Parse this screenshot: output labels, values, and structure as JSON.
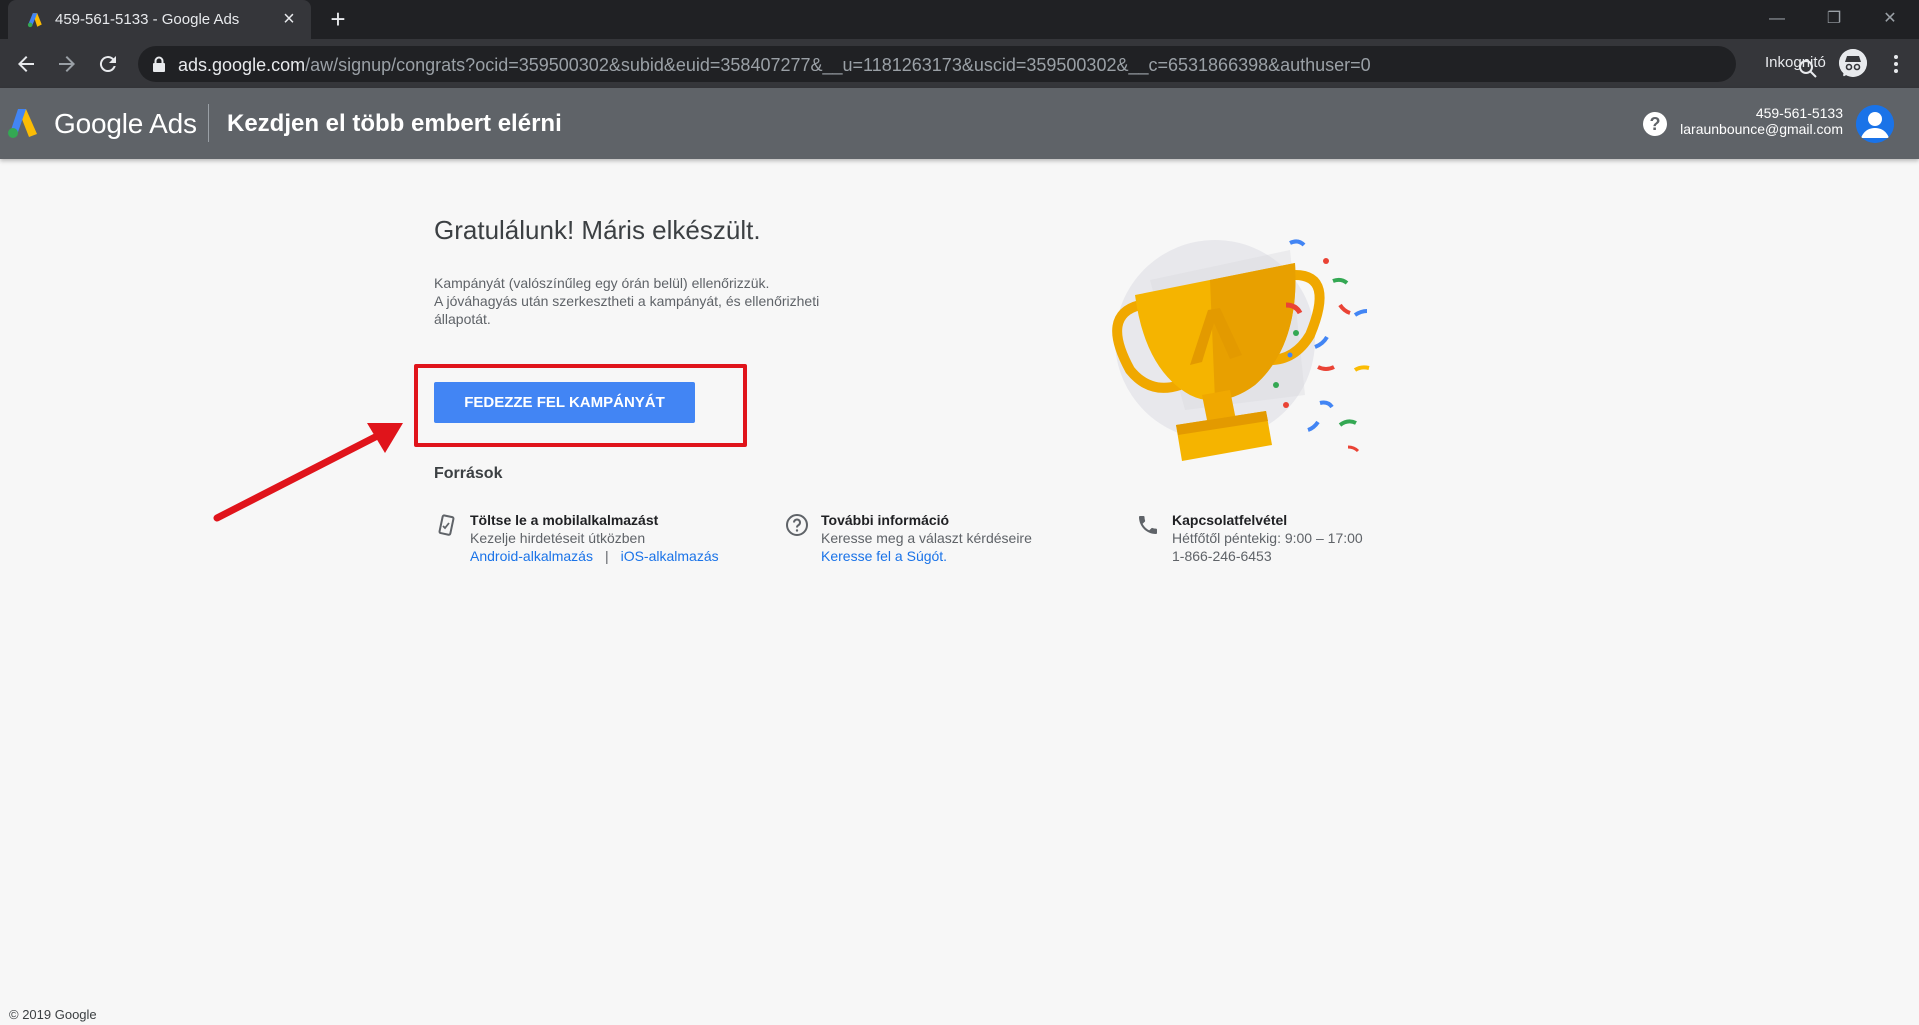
{
  "browser": {
    "tab_title": "459-561-5133 - Google Ads",
    "tab_close": "×",
    "new_tab": "+",
    "url_host": "ads.google.com",
    "url_path": "/aw/signup/congrats?ocid=359500302&subid&euid=358407277&__u=1181263173&uscid=359500302&__c=6531866398&authuser=0",
    "incognito_label": "Inkognitó"
  },
  "header": {
    "brand": "Google Ads",
    "title": "Kezdjen el több embert elérni",
    "help": "?",
    "account_id": "459-561-5133",
    "account_email": "laraunbounce@gmail.com"
  },
  "main": {
    "title": "Gratulálunk! Máris elkészült.",
    "desc_line1": "Kampányát (valószínűleg egy órán belül) ellenőrizzük.",
    "desc_line2": "A jóváhagyás után szerkesztheti a kampányát, és ellenőrizheti állapotát.",
    "cta": "FEDEZZE FEL KAMPÁNYÁT",
    "resources_heading": "Források"
  },
  "resources": [
    {
      "title": "Töltse le a mobilalkalmazást",
      "line": "Kezelje hirdetéseit útközben",
      "link1": "Android-alkalmazás",
      "separator": "|",
      "link2": "iOS-alkalmazás"
    },
    {
      "title": "További információ",
      "line": "Keresse meg a választ kérdéseire",
      "link": "Keresse fel a Súgót."
    },
    {
      "title": "Kapcsolatfelvétel",
      "line": "Hétfőtől péntekig: 9:00 – 17:00",
      "phone": "1-866-246-6453"
    }
  ],
  "footer": {
    "copyright": "© 2019 Google"
  },
  "colors": {
    "accent": "#4285f4",
    "header_bg": "#5f6368",
    "annotation": "#e0141b",
    "link": "#1a73e8"
  }
}
